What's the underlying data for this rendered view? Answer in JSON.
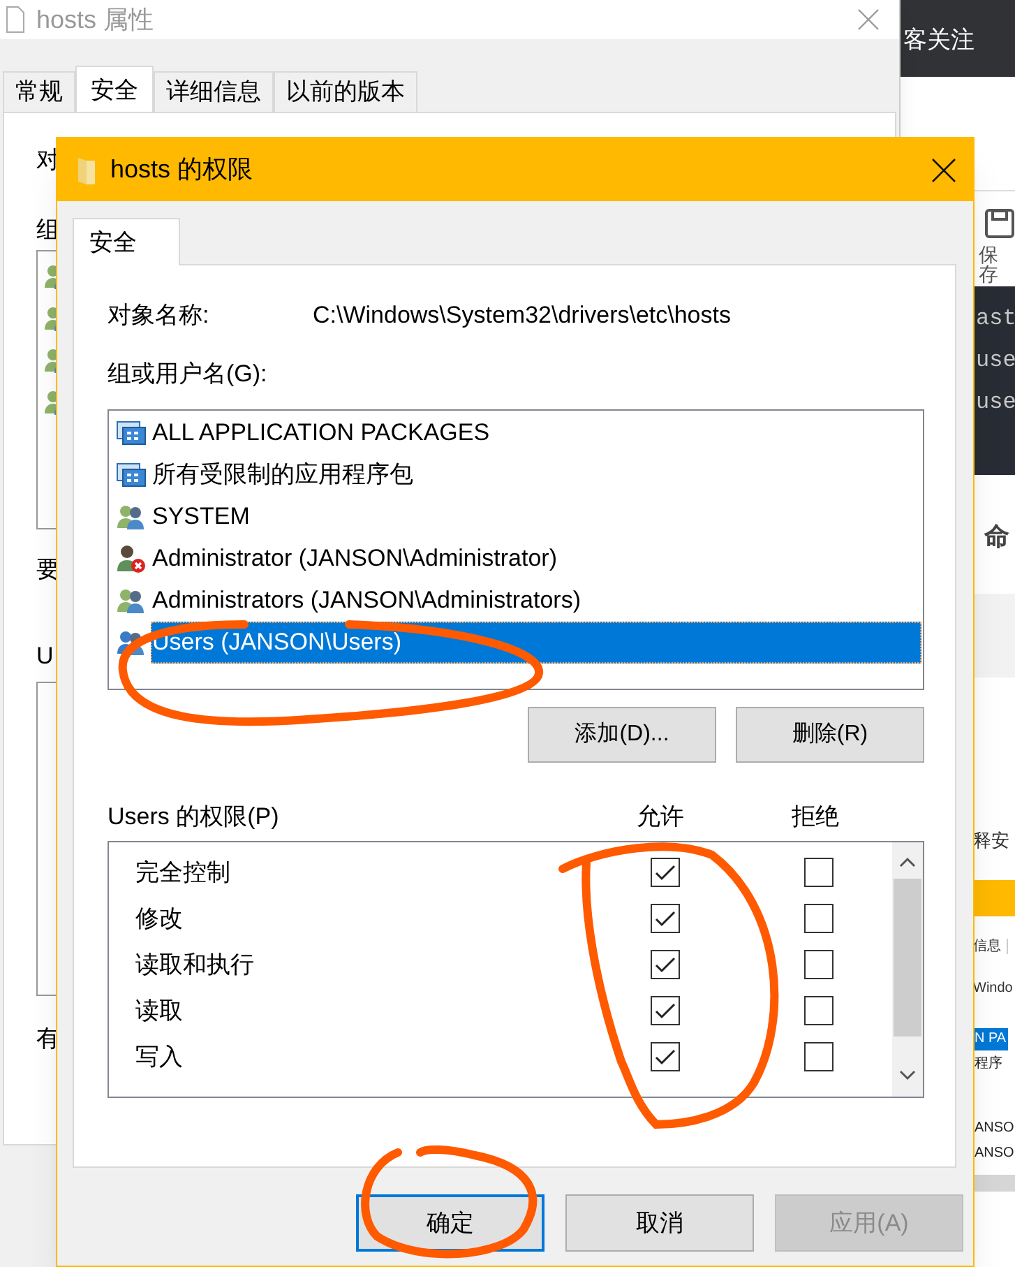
{
  "background_window": {
    "title": "hosts 属性",
    "tabs": [
      {
        "label": "常规",
        "selected": false
      },
      {
        "label": "安全",
        "selected": true
      },
      {
        "label": "详细信息",
        "selected": false
      },
      {
        "label": "以前的版本",
        "selected": false
      }
    ],
    "visible_labels": [
      "对",
      "组",
      "要",
      "U",
      "有"
    ]
  },
  "browser_behind": {
    "header_text": "客关注",
    "toolbar_label": "保存",
    "code_lines": [
      "ast",
      "use",
      "use"
    ],
    "heading": "命",
    "text_fragment": "释安",
    "tab_fragment": "信息",
    "path_fragment": "Windo",
    "list_fragments": [
      {
        "text": "N PA",
        "selected": true
      },
      {
        "text": "程序",
        "selected": false
      },
      {
        "text": "ANSO",
        "selected": false
      },
      {
        "text": "ANSO",
        "selected": false
      }
    ]
  },
  "dialog": {
    "title": "hosts 的权限",
    "tabs": [
      {
        "label": "安全",
        "selected": true
      }
    ],
    "object_label": "对象名称:",
    "object_path": "C:\\Windows\\System32\\drivers\\etc\\hosts",
    "group_label": "组或用户名(G):",
    "principals": [
      {
        "name": "ALL APPLICATION PACKAGES",
        "kind": "packages",
        "selected": false
      },
      {
        "name": "所有受限制的应用程序包",
        "kind": "packages",
        "selected": false
      },
      {
        "name": "SYSTEM",
        "kind": "group",
        "selected": false
      },
      {
        "name": "Administrator (JANSON\\Administrator)",
        "kind": "user-error",
        "selected": false
      },
      {
        "name": "Administrators (JANSON\\Administrators)",
        "kind": "group",
        "selected": false
      },
      {
        "name": "Users (JANSON\\Users)",
        "kind": "group",
        "selected": true
      }
    ],
    "add_button": "添加(D)...",
    "remove_button": "删除(R)",
    "permissions_label": "Users 的权限(P)",
    "allow_header": "允许",
    "deny_header": "拒绝",
    "permissions": [
      {
        "name": "完全控制",
        "allow": true,
        "deny": false
      },
      {
        "name": "修改",
        "allow": true,
        "deny": false
      },
      {
        "name": "读取和执行",
        "allow": true,
        "deny": false
      },
      {
        "name": "读取",
        "allow": true,
        "deny": false
      },
      {
        "name": "写入",
        "allow": true,
        "deny": false
      }
    ],
    "footer_buttons": [
      {
        "label": "确定",
        "focused": true,
        "disabled": false
      },
      {
        "label": "取消",
        "focused": false,
        "disabled": false
      },
      {
        "label": "应用(A)",
        "focused": false,
        "disabled": true
      }
    ]
  }
}
